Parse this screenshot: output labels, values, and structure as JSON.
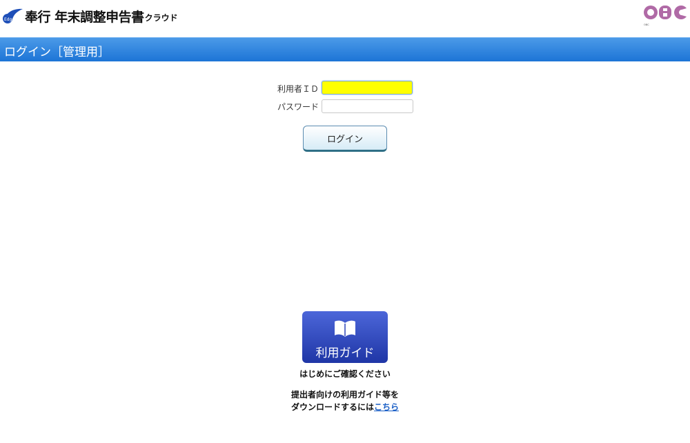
{
  "header": {
    "brand_small": "Edge",
    "app_name": "奉行 年末調整申告書",
    "app_suffix": "クラウド",
    "corp_logo": "OBC"
  },
  "title_bar": {
    "title": "ログイン［管理用］"
  },
  "login_form": {
    "user_id_label": "利用者ＩＤ",
    "user_id_value": "",
    "password_label": "パスワード",
    "password_value": "",
    "login_button": "ログイン"
  },
  "guide": {
    "icon": "book-icon",
    "button_label": "利用ガイド",
    "caption": "はじめにご確認ください",
    "note_line1": "提出者向けの利用ガイド等を",
    "note_line2_prefix": "ダウンロードするには",
    "note_link": "こちら"
  },
  "colors": {
    "title_bar": "#2a82e0",
    "active_input": "#ffff00",
    "guide_button": "#2c44b8",
    "link": "#1a5fc6"
  }
}
